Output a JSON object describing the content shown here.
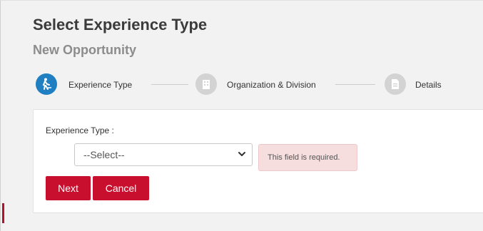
{
  "header": {
    "title": "Select Experience Type",
    "subtitle": "New Opportunity"
  },
  "steps": [
    {
      "label": "Experience Type",
      "icon": "hiking-person-icon",
      "state": "active"
    },
    {
      "label": "Organization & Division",
      "icon": "building-icon",
      "state": "inactive"
    },
    {
      "label": "Details",
      "icon": "document-icon",
      "state": "inactive"
    }
  ],
  "form": {
    "field_label": "Experience Type :",
    "select_value": "--Select--",
    "validation_message": "This field is required."
  },
  "buttons": {
    "next": "Next",
    "cancel": "Cancel"
  },
  "colors": {
    "accent_red": "#c8102e",
    "step_active": "#1f7fc0",
    "step_inactive": "#d3d3d3",
    "error_bg": "#f6dede"
  }
}
